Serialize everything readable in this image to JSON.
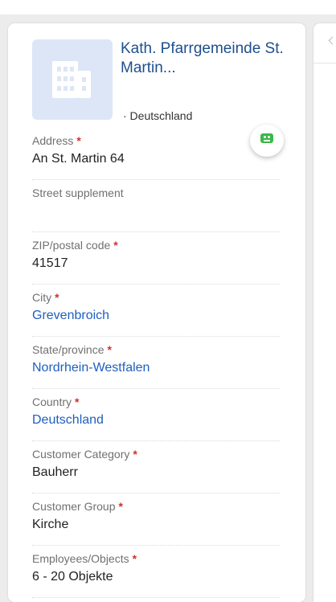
{
  "header": {
    "org_name": "Kath. Pfarrgemeinde St. Martin...",
    "org_country": "· Deutschland"
  },
  "fields": [
    {
      "label": "Address",
      "required": "*",
      "value": "An St. Martin 64",
      "link": false
    },
    {
      "label": "Street supplement",
      "required": "",
      "value": "",
      "link": false
    },
    {
      "label": "ZIP/postal code",
      "required": "*",
      "value": "41517",
      "link": false
    },
    {
      "label": "City",
      "required": "*",
      "value": "Grevenbroich",
      "link": true
    },
    {
      "label": "State/province",
      "required": "*",
      "value": "Nordrhein-Westfalen",
      "link": true
    },
    {
      "label": "Country",
      "required": "*",
      "value": "Deutschland",
      "link": true
    },
    {
      "label": "Customer Category",
      "required": "*",
      "value": "Bauherr",
      "link": false
    },
    {
      "label": "Customer Group",
      "required": "*",
      "value": "Kirche",
      "link": false
    },
    {
      "label": "Employees/Objects",
      "required": "*",
      "value": "6 - 20 Objekte",
      "link": false
    }
  ],
  "colors": {
    "link": "#1f5fbf",
    "required": "#d0312d",
    "avatar_bg": "#dde6f6",
    "bot": "#3bb84a"
  },
  "icons": {
    "avatar": "building-icon",
    "assistant": "robot-icon"
  }
}
